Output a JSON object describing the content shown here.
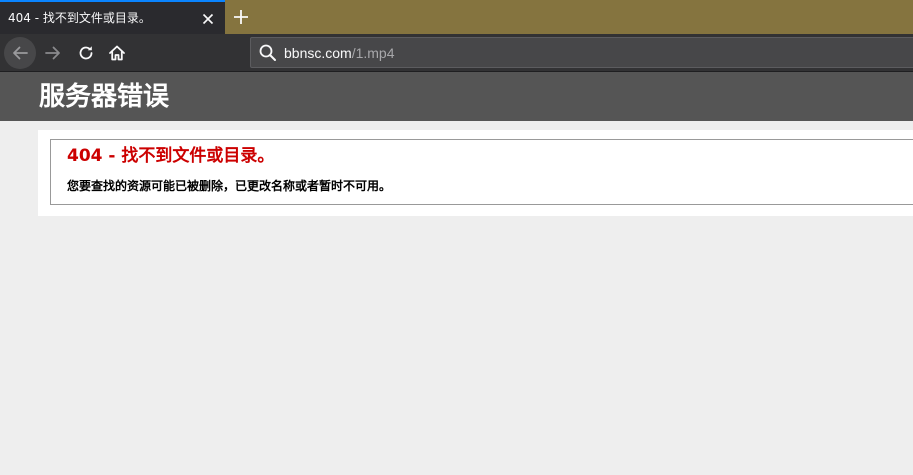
{
  "browser": {
    "tab": {
      "title": "404 - 找不到文件或目录。"
    },
    "url": {
      "host": "bbnsc.com",
      "path": "/1.mp4"
    },
    "icons": {
      "tab_close": "close-icon",
      "new_tab": "plus-icon",
      "back": "arrow-left-icon",
      "forward": "arrow-right-icon",
      "reload": "reload-icon",
      "home": "home-icon",
      "url": "search-icon"
    },
    "colors": {
      "tabstrip": "#85743f",
      "tab_active": "#2a2a2e",
      "tab_accent": "#0a84ff",
      "toolbar": "#323234",
      "urlbar": "#474749"
    }
  },
  "page": {
    "header_title": "服务器错误",
    "error_title": "404 - 找不到文件或目录。",
    "error_description": "您要查找的资源可能已被删除，已更改名称或者暂时不可用。",
    "colors": {
      "header_bg": "#555555",
      "error_title": "#cc0000",
      "background": "#eeeeee"
    }
  }
}
